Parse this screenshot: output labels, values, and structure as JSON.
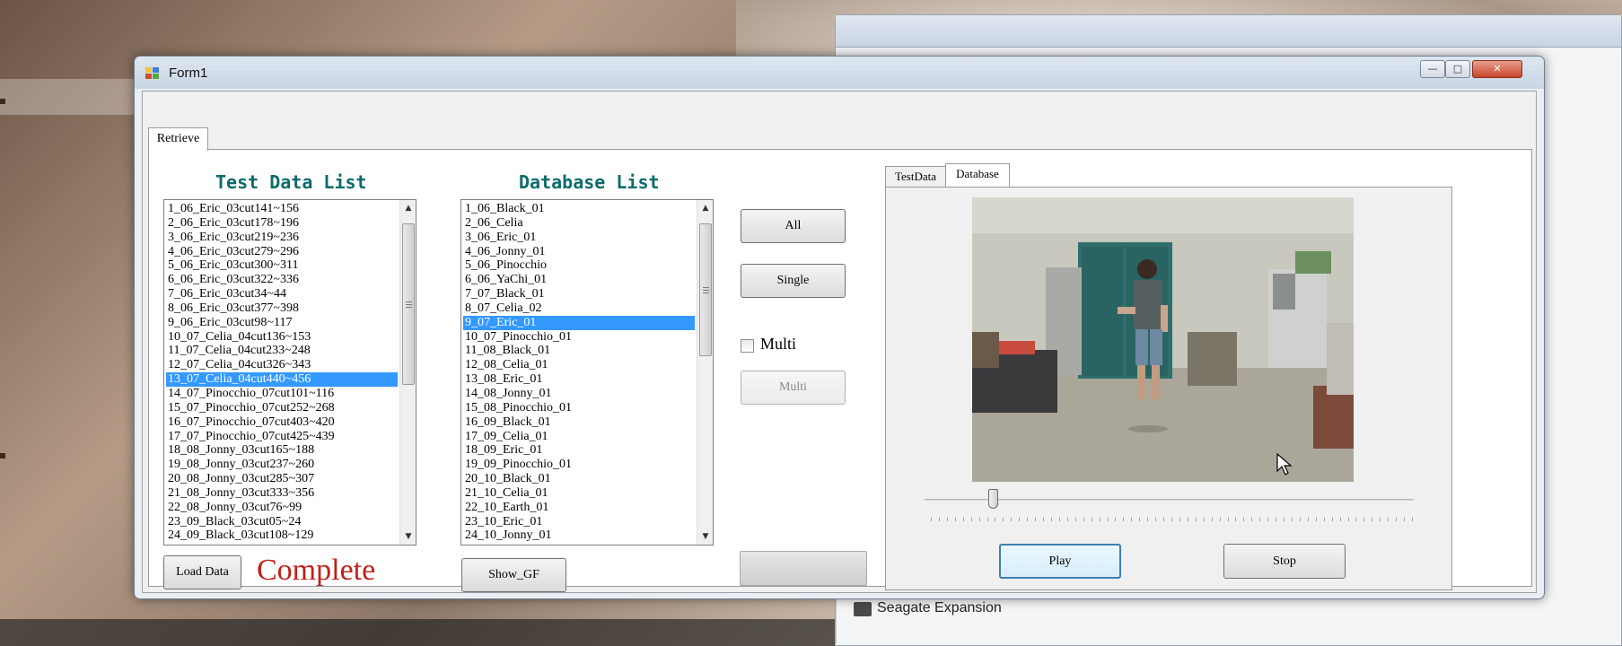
{
  "desktop": {
    "background_window_footer": "Seagate Expansion"
  },
  "window": {
    "title": "Form1",
    "controls": {
      "minimize": "—",
      "maximize": "□",
      "close": "✕"
    }
  },
  "main_tab": {
    "label": "Retrieve"
  },
  "test_data": {
    "title": "Test Data List",
    "items": [
      "1_06_Eric_03cut141~156",
      "2_06_Eric_03cut178~196",
      "3_06_Eric_03cut219~236",
      "4_06_Eric_03cut279~296",
      "5_06_Eric_03cut300~311",
      "6_06_Eric_03cut322~336",
      "7_06_Eric_03cut34~44",
      "8_06_Eric_03cut377~398",
      "9_06_Eric_03cut98~117",
      "10_07_Celia_04cut136~153",
      "11_07_Celia_04cut233~248",
      "12_07_Celia_04cut326~343",
      "13_07_Celia_04cut440~456",
      "14_07_Pinocchio_07cut101~116",
      "15_07_Pinocchio_07cut252~268",
      "16_07_Pinocchio_07cut403~420",
      "17_07_Pinocchio_07cut425~439",
      "18_08_Jonny_03cut165~188",
      "19_08_Jonny_03cut237~260",
      "20_08_Jonny_03cut285~307",
      "21_08_Jonny_03cut333~356",
      "22_08_Jonny_03cut76~99",
      "23_09_Black_03cut05~24",
      "24_09_Black_03cut108~129"
    ],
    "selected": "13_07_Celia_04cut440~456",
    "load_button": "Load Data",
    "status": "Complete"
  },
  "database": {
    "title": "Database List",
    "items": [
      "1_06_Black_01",
      "2_06_Celia",
      "3_06_Eric_01",
      "4_06_Jonny_01",
      "5_06_Pinocchio",
      "6_06_YaChi_01",
      "7_07_Black_01",
      "8_07_Celia_02",
      "9_07_Eric_01",
      "10_07_Pinocchio_01",
      "11_08_Black_01",
      "12_08_Celia_01",
      "13_08_Eric_01",
      "14_08_Jonny_01",
      "15_08_Pinocchio_01",
      "16_09_Black_01",
      "17_09_Celia_01",
      "18_09_Eric_01",
      "19_09_Pinocchio_01",
      "20_10_Black_01",
      "21_10_Celia_01",
      "22_10_Earth_01",
      "23_10_Eric_01",
      "24_10_Jonny_01"
    ],
    "selected": "9_07_Eric_01",
    "show_button": "Show_GF"
  },
  "controls": {
    "all_button": "All",
    "single_button": "Single",
    "multi_checkbox_label": "Multi",
    "multi_checkbox_checked": false,
    "multi_button": "Multi"
  },
  "viewer": {
    "tabs": [
      "TestData",
      "Database"
    ],
    "active_tab": "Database",
    "trackbar_fraction": 0.14,
    "play_button": "Play",
    "stop_button": "Stop"
  },
  "colors": {
    "title_teal": "#0c6b6b",
    "status_red": "#c0201a",
    "selection_blue": "#3399ff"
  }
}
